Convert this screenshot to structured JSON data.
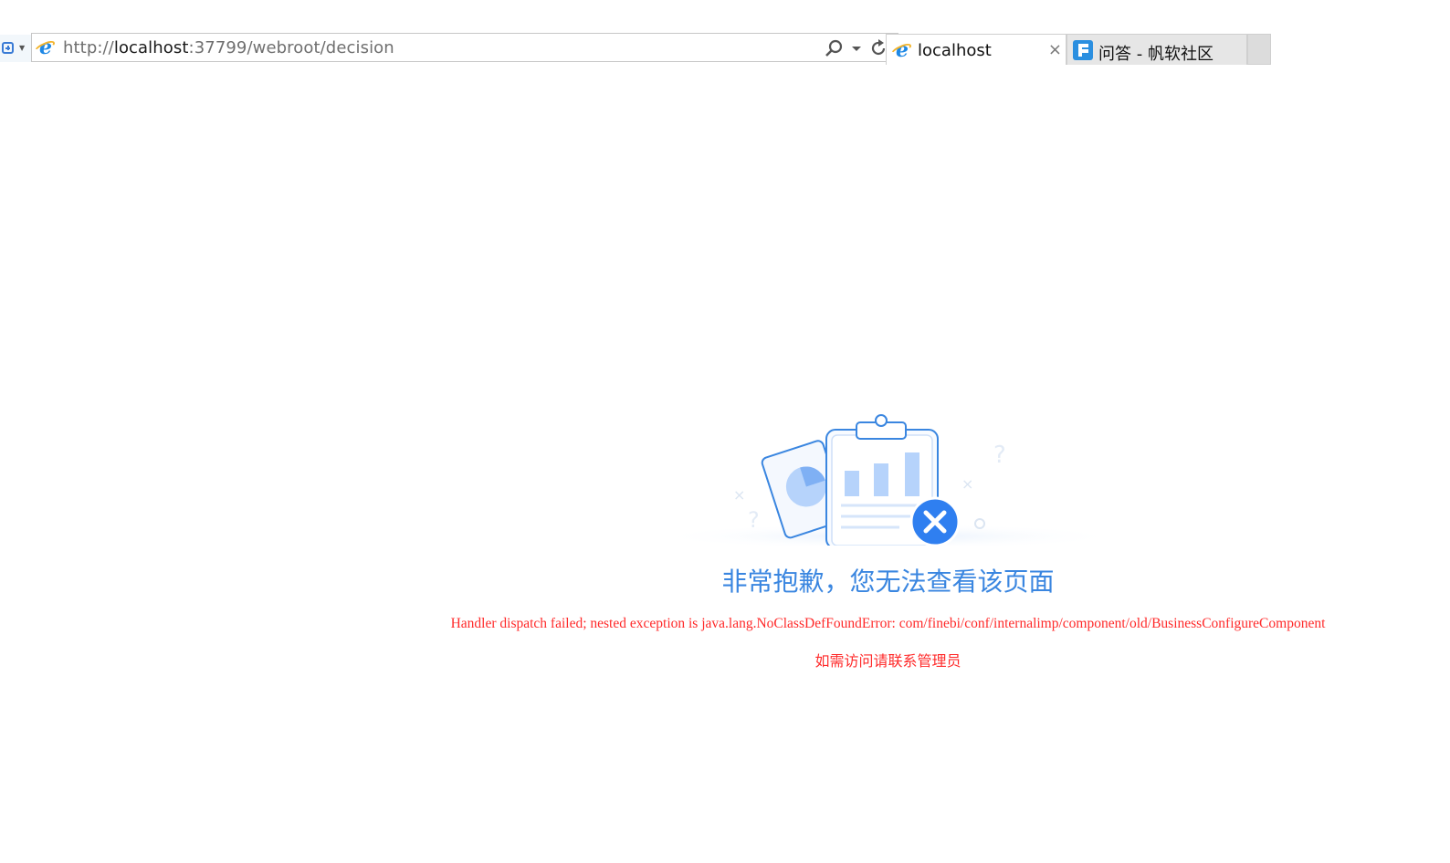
{
  "browser": {
    "address_bar": {
      "url_prefix": "http://",
      "url_host": "localhost",
      "url_rest": ":37799/webroot/decision"
    },
    "tabs": [
      {
        "label": "localhost",
        "active": true,
        "icon": "ie-icon",
        "close": "×"
      },
      {
        "label": "问答 - 帆软社区",
        "active": false,
        "icon": "fanruan-icon"
      }
    ]
  },
  "error_page": {
    "title": "非常抱歉，您无法查看该页面",
    "detail": "Handler dispatch failed; nested exception is java.lang.NoClassDefFoundError: com/finebi/conf/internalimp/component/old/BusinessConfigureComponent",
    "contact": "如需访问请联系管理员",
    "colors": {
      "title": "#3a86e0",
      "error_text": "#ff2a2a",
      "accent": "#2f7ff0"
    }
  }
}
